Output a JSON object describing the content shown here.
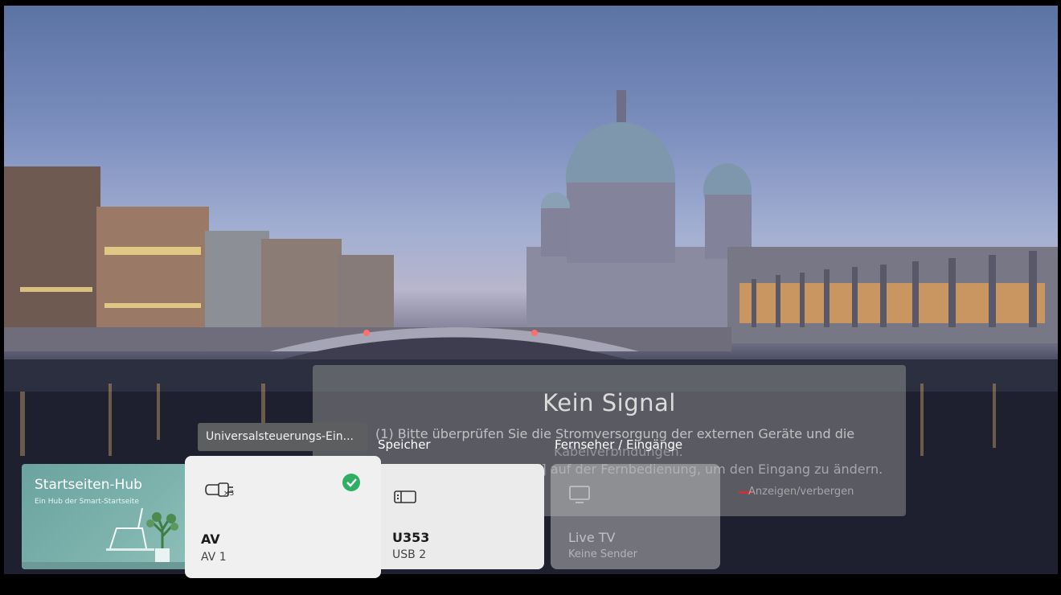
{
  "signal": {
    "title": "Kein Signal",
    "line1": "(1) Bitte überprüfen Sie die Stromversorgung der externen Geräte und die",
    "line2": "Kabelverbindungen.",
    "line3": "(2) Drücken Sie die Taste [⏎] auf der Fernbedienung, um den Eingang zu ändern.",
    "toggle_hint": "Anzeigen/verbergen"
  },
  "tooltip": "Universalsteuerungs-Ein...",
  "sections": {
    "storage": "Speicher",
    "tv_inputs": "Fernseher / Eingänge"
  },
  "hub": {
    "title": "Startseiten-Hub",
    "subtitle": "Ein Hub der Smart-Startseite"
  },
  "cards": [
    {
      "name": "AV",
      "sub": "AV 1",
      "icon": "av-cable-icon",
      "icon_badge": "×3",
      "selected": true
    },
    {
      "name": "U353",
      "sub": "USB 2",
      "icon": "usb-drive-icon"
    },
    {
      "name": "Live TV",
      "sub": "Keine Sender",
      "icon": "tv-icon"
    }
  ],
  "colors": {
    "selected_check": "#2fae64",
    "hub_card": "#7eb3ad",
    "toggle_red": "#c8323b"
  }
}
